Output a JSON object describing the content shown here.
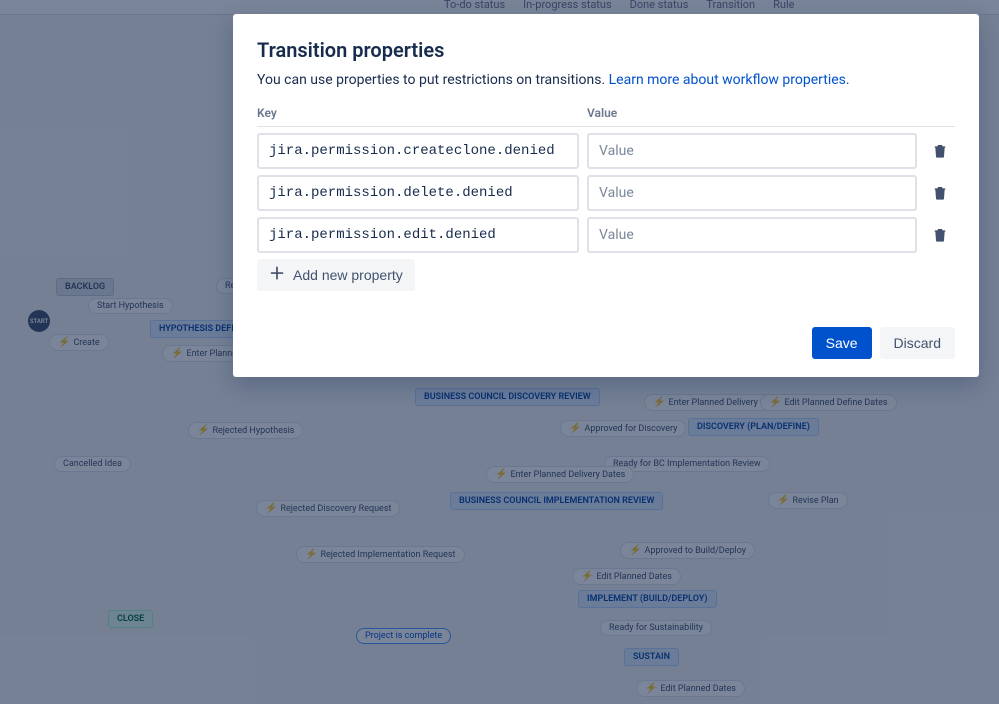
{
  "legend": {
    "todo": "To-do status",
    "inprogress": "In-progress status",
    "done": "Done status",
    "transition": "Transition",
    "rule": "Rule"
  },
  "canvas": {
    "start": "START",
    "nodes": {
      "backlog": "BACKLOG",
      "hypothesis_def": "HYPOTHESIS DEFINITION",
      "bc_discovery": "BUSINESS COUNCIL DISCOVERY REVIEW",
      "discovery": "DISCOVERY (PLAN/DEFINE)",
      "bc_implementation": "BUSINESS COUNCIL IMPLEMENTATION REVIEW",
      "implement": "IMPLEMENT (BUILD/DEPLOY)",
      "sustain": "SUSTAIN",
      "close": "CLOSE"
    },
    "pills": {
      "start_hypothesis": "Start Hypothesis",
      "create": "Create",
      "enter_planned_dates": "Enter Planned Dates",
      "rejected_hypothesis": "Rejected Hypothesis",
      "cancelled_idea": "Cancelled Idea",
      "approved_discovery": "Approved for Discovery",
      "enter_planned_delivery_dates": "Enter Planned Delivery Dates",
      "edit_planned_define_dates": "Edit Planned Define Dates",
      "ready_bc_impl": "Ready for BC Implementation Review",
      "revise_plan": "Revise Plan",
      "rejected_discovery": "Rejected Discovery Request",
      "approved_build": "Approved to Build/Deploy",
      "rejected_impl": "Rejected Implementation Request",
      "edit_planned_dates": "Edit Planned Dates",
      "ready_sustain": "Ready for Sustainability",
      "project_complete": "Project is complete",
      "re": "Re"
    }
  },
  "modal": {
    "title": "Transition properties",
    "description_text": "You can use properties to put restrictions on transitions. ",
    "description_link": "Learn more about workflow properties",
    "description_tail": ".",
    "header_key": "Key",
    "header_value": "Value",
    "rows": [
      {
        "key": "jira.permission.createclone.denied",
        "value": ""
      },
      {
        "key": "jira.permission.delete.denied",
        "value": ""
      },
      {
        "key": "jira.permission.edit.denied",
        "value": ""
      }
    ],
    "value_placeholder": "Value",
    "add_new": "Add new property",
    "save": "Save",
    "discard": "Discard"
  }
}
